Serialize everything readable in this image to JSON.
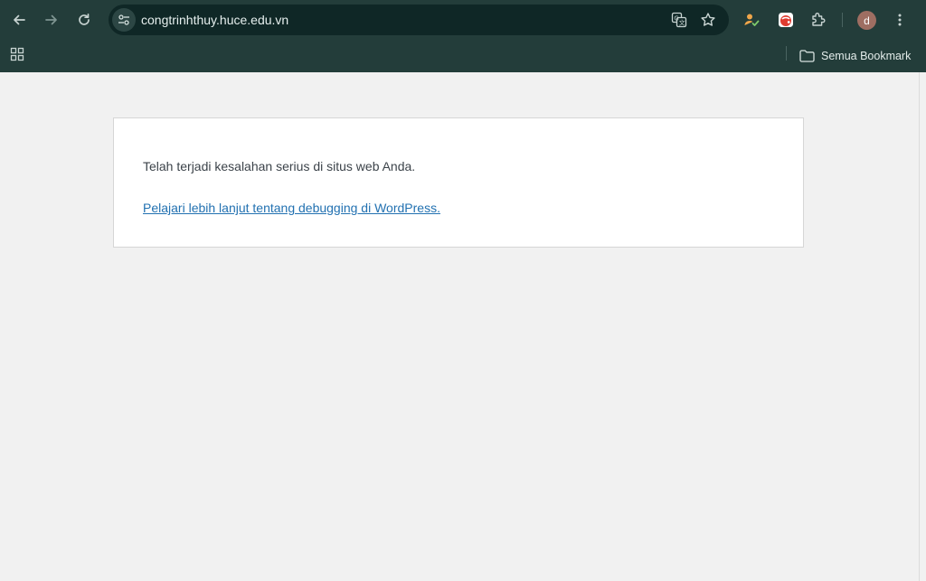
{
  "browser": {
    "url": "congtrinhthuy.huce.edu.vn",
    "avatar_initial": "d",
    "bookmarks_all_label": "Semua Bookmark"
  },
  "page": {
    "message": "Telah terjadi kesalahan serius di situs web Anda.",
    "link_text": "Pelajari lebih lanjut tentang debugging di WordPress."
  },
  "icons": {
    "back": "back-arrow-icon",
    "forward": "forward-arrow-icon",
    "reload": "reload-icon",
    "site_info": "tune-icon",
    "translate": "translate-icon",
    "bookmark": "star-icon",
    "extension_1": "person-check-icon",
    "extension_2": "red-extension-icon",
    "extensions": "puzzle-icon",
    "menu": "kebab-menu-icon",
    "apps": "apps-grid-icon",
    "folder": "folder-icon"
  },
  "colors": {
    "chrome_bg": "#233d3a",
    "omnibox_bg": "#0f2726",
    "page_bg": "#f1f1f1",
    "text": "#3c434a",
    "link": "#2271b1"
  }
}
